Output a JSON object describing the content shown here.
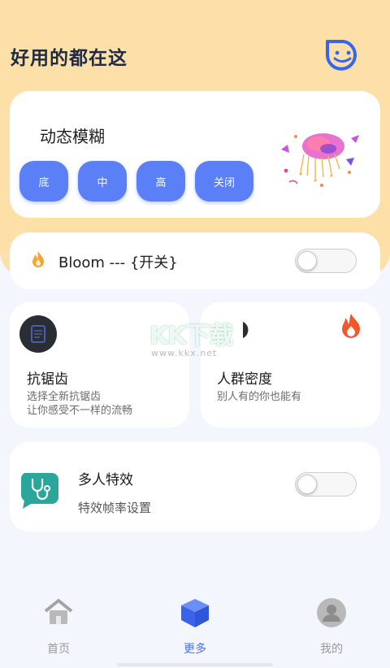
{
  "header": {
    "title": "好用的都在这",
    "icon": "face-icon"
  },
  "motion_blur": {
    "title": "动态模糊",
    "options": [
      "底",
      "中",
      "高",
      "关闭"
    ]
  },
  "bloom": {
    "label": "Bloom --- {开关}",
    "enabled": false
  },
  "features": [
    {
      "title": "抗锯齿",
      "desc_line1": "选择全新抗锯齿",
      "desc_line2": "让你感受不一样的流畅"
    },
    {
      "title": "人群密度",
      "desc_line1": "别人有的你也能有"
    }
  ],
  "multiplayer": {
    "title": "多人特效",
    "subtitle": "特效帧率设置",
    "enabled": false
  },
  "watermark": {
    "text": "KK下载",
    "url": "www.kkx.net"
  },
  "nav": {
    "items": [
      {
        "label": "首页",
        "icon": "home-icon",
        "active": false
      },
      {
        "label": "更多",
        "icon": "cube-icon",
        "active": true
      },
      {
        "label": "我的",
        "icon": "profile-icon",
        "active": false
      }
    ]
  },
  "colors": {
    "top_background": "#fde0a8",
    "accent_blue": "#5a7ff7",
    "nav_active": "#4a6ff0",
    "fire_orange": "#f1572b",
    "teal_icon": "#2aa79a"
  }
}
